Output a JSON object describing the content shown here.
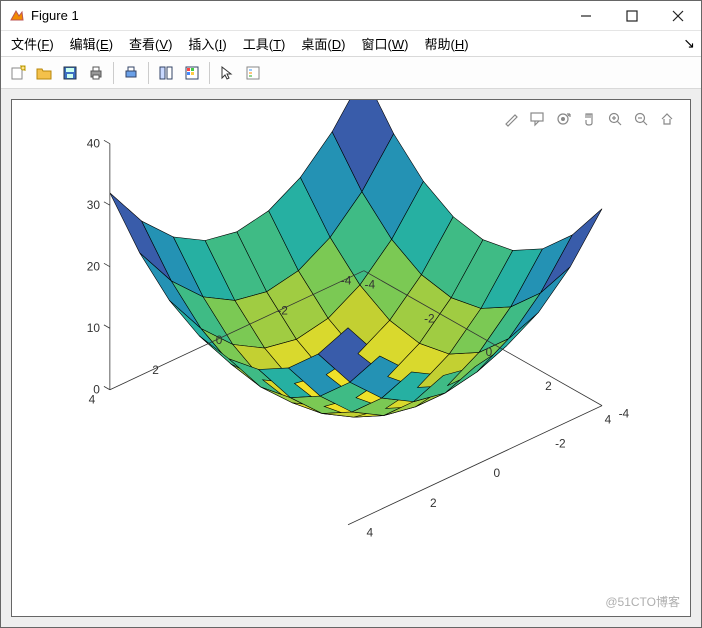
{
  "window": {
    "title": "Figure 1",
    "watermark": "@51CTO博客"
  },
  "menu": {
    "items": [
      {
        "label": "文件",
        "accel": "F"
      },
      {
        "label": "编辑",
        "accel": "E"
      },
      {
        "label": "查看",
        "accel": "V"
      },
      {
        "label": "插入",
        "accel": "I"
      },
      {
        "label": "工具",
        "accel": "T"
      },
      {
        "label": "桌面",
        "accel": "D"
      },
      {
        "label": "窗口",
        "accel": "W"
      },
      {
        "label": "帮助",
        "accel": "H"
      }
    ]
  },
  "toolbar": {
    "items": [
      "new-figure-icon",
      "open-icon",
      "save-icon",
      "print-icon",
      "|",
      "print-preview-icon",
      "|",
      "link-icon",
      "colorbar-icon",
      "|",
      "pointer-icon",
      "insert-legend-icon"
    ]
  },
  "axes_toolbar": {
    "items": [
      "brush-icon",
      "datatips-icon",
      "rotate3d-icon",
      "pan-icon",
      "zoom-in-icon",
      "zoom-out-icon",
      "home-icon"
    ]
  },
  "chart_data": {
    "type": "surface3d",
    "function": "z = x^2 + y^2",
    "x_range": [
      -4,
      4
    ],
    "y_range": [
      -4,
      4
    ],
    "z_range": [
      0,
      40
    ],
    "step": 1,
    "x_ticks": [
      -4,
      -2,
      0,
      2,
      4
    ],
    "y_ticks": [
      -4,
      -2,
      0,
      2,
      4
    ],
    "z_ticks": [
      0,
      10,
      20,
      30,
      40
    ],
    "colormap": "parula",
    "shading": "flat"
  }
}
